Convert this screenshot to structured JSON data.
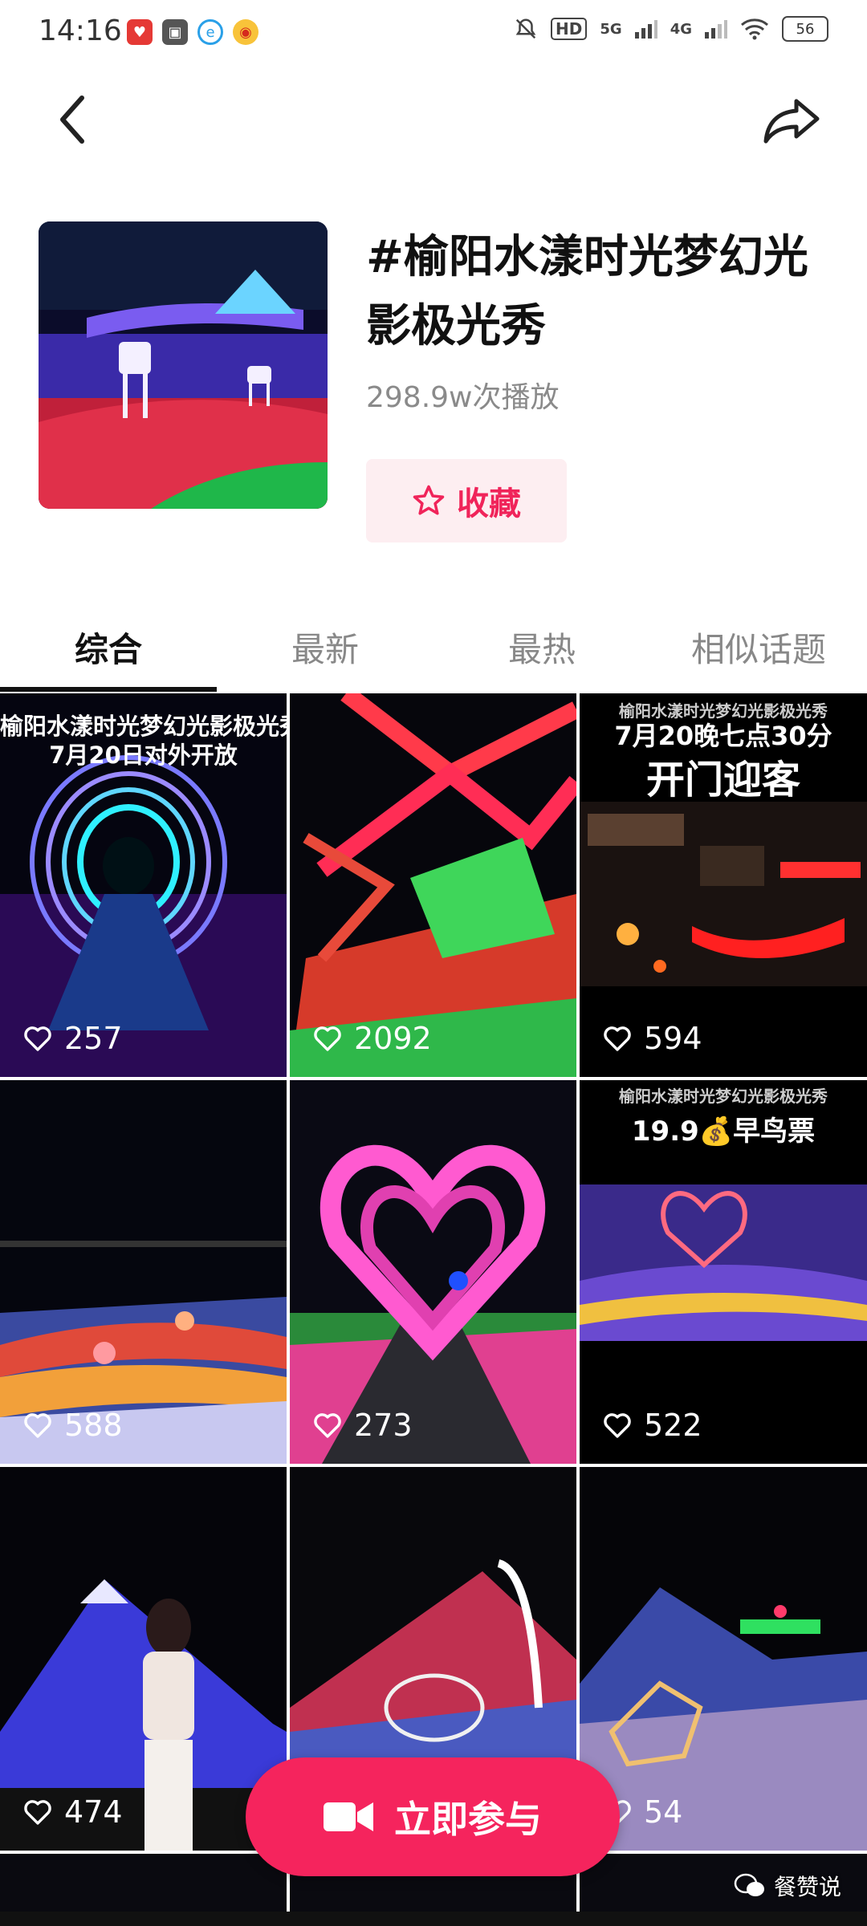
{
  "status_bar": {
    "time": "14:16",
    "left_icons": [
      "heart-app-icon",
      "box-app-icon",
      "browser-app-icon",
      "weibo-icon"
    ],
    "hd_label": "HD",
    "net1": "5G",
    "net2": "4G",
    "battery": "56"
  },
  "topic": {
    "title": "#榆阳水漾时光梦幻光影极光秀",
    "plays": "298.9w次播放",
    "favorite_label": "收藏"
  },
  "tabs": [
    {
      "label": "综合",
      "active": true
    },
    {
      "label": "最新",
      "active": false
    },
    {
      "label": "最热",
      "active": false
    },
    {
      "label": "相似话题",
      "active": false
    }
  ],
  "videos": [
    {
      "likes": "257",
      "overlay_lines": [
        "榆阳水漾时光梦幻光影极光秀",
        "7月20日对外开放"
      ]
    },
    {
      "likes": "2092"
    },
    {
      "likes": "594",
      "overlay_lines": [
        "榆阳水漾时光梦幻光影极光秀",
        "7月20晚七点30分",
        "开门迎客"
      ]
    },
    {
      "likes": "588"
    },
    {
      "likes": "273"
    },
    {
      "likes": "522",
      "overlay_lines": [
        "榆阳水漾时光梦幻光影极光秀",
        "19.9💰早鸟票"
      ]
    },
    {
      "likes": "474"
    },
    {
      "likes": ""
    },
    {
      "likes": "54"
    }
  ],
  "join_button": {
    "label": "立即参与"
  },
  "watermark": "餐赞说",
  "colors": {
    "accent": "#f5245d",
    "favorite_bg": "#fdeef1"
  }
}
